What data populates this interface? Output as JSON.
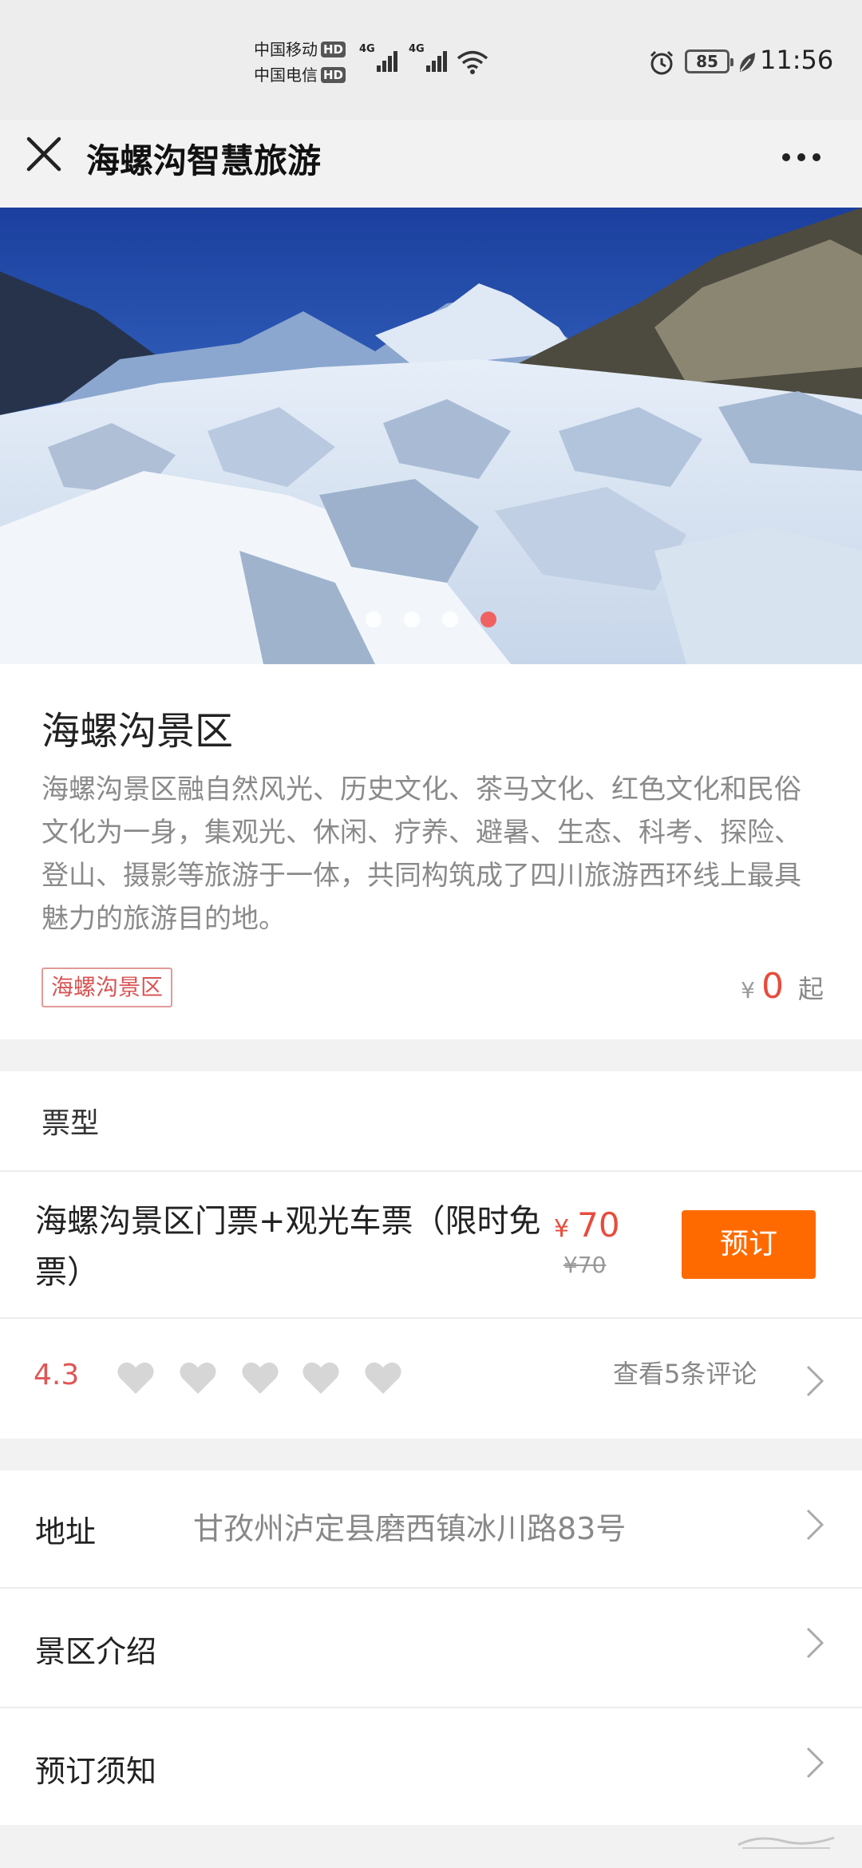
{
  "status_bar": {
    "carrier1": "中国移动",
    "carrier2": "中国电信",
    "hd": "HD",
    "network": "4G",
    "battery": "85",
    "time": "11:56"
  },
  "header": {
    "title": "海螺沟智慧旅游",
    "close_icon": "close-icon",
    "more_icon": "more-icon"
  },
  "banner": {
    "slides": 4,
    "active_slide": 4
  },
  "scenic": {
    "name": "海螺沟景区",
    "description": "海螺沟景区融自然风光、历史文化、茶马文化、红色文化和民俗文化为一身，集观光、休闲、疗养、避暑、生态、科考、探险、登山、摄影等旅游于一体，共同构筑成了四川旅游西环线上最具魅力的旅游目的地。",
    "tag": "海螺沟景区",
    "price_currency": "¥",
    "price": "0",
    "price_suffix": "起"
  },
  "tickets": {
    "section_title": "票型",
    "items": [
      {
        "name": "海螺沟景区门票+观光车票（限时免票）",
        "price_currency": "¥",
        "price": "70",
        "original_price": "¥70",
        "book_label": "预订"
      }
    ]
  },
  "reviews": {
    "rating": "4.3",
    "hearts": 5,
    "link_label": "查看5条评论"
  },
  "info_rows": {
    "address_label": "地址",
    "address_value": "甘孜州泸定县磨西镇冰川路83号",
    "intro_label": "景区介绍",
    "notice_label": "预订须知"
  },
  "colors": {
    "accent_orange": "#ff6a00",
    "price_red": "#e74c3c",
    "dot_active": "#f06262"
  }
}
